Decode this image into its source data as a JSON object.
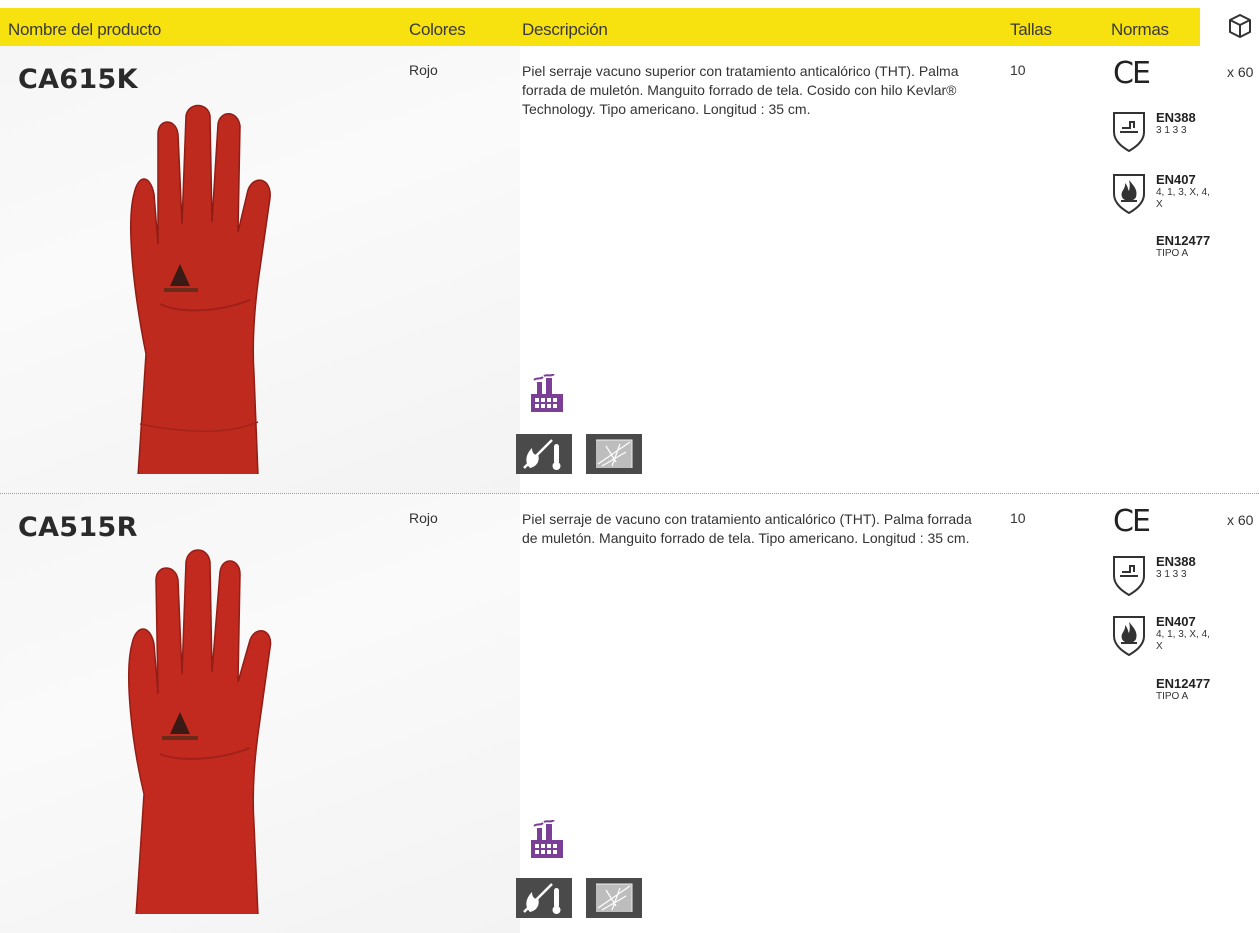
{
  "header": {
    "product_name": "Nombre del producto",
    "colors": "Colores",
    "description": "Descripción",
    "sizes": "Tallas",
    "norms": "Normas",
    "package_icon": "box-icon",
    "background_color": "#f7e10f"
  },
  "products": [
    {
      "name": "CA615K",
      "color": "Rojo",
      "description": "Piel serraje vacuno superior con tratamiento anticalórico (THT). Palma forrada de muletón. Manguito forrado de tela. Cosido con hilo Kevlar® Technology. Tipo americano. Longitud : 35 cm.",
      "size": "10",
      "quantity": "x 60",
      "ce_mark": "CE",
      "norms": [
        {
          "code": "EN388",
          "levels": "3 1 3 3",
          "icon": "mechanical-risk-shield-icon"
        },
        {
          "code": "EN407",
          "levels": "4, 1, 3, X, 4, X",
          "icon": "heat-flame-shield-icon"
        },
        {
          "code": "EN12477",
          "levels": "TIPO A"
        }
      ],
      "pictograms": [
        "industry-factory-icon",
        "heat-thermometer-icon",
        "welding-sparks-icon"
      ],
      "glove_color": "#c0281e"
    },
    {
      "name": "CA515R",
      "color": "Rojo",
      "description": "Piel serraje de vacuno con tratamiento anticalórico (THT). Palma forrada de muletón. Manguito forrado de tela. Tipo americano. Longitud : 35 cm.",
      "size": "10",
      "quantity": "x 60",
      "ce_mark": "CE",
      "norms": [
        {
          "code": "EN388",
          "levels": "3 1 3 3",
          "icon": "mechanical-risk-shield-icon"
        },
        {
          "code": "EN407",
          "levels": "4, 1, 3, X, 4, X",
          "icon": "heat-flame-shield-icon"
        },
        {
          "code": "EN12477",
          "levels": "TIPO A"
        }
      ],
      "pictograms": [
        "industry-factory-icon",
        "heat-thermometer-icon",
        "welding-sparks-icon"
      ],
      "glove_color": "#c22a1f"
    }
  ]
}
